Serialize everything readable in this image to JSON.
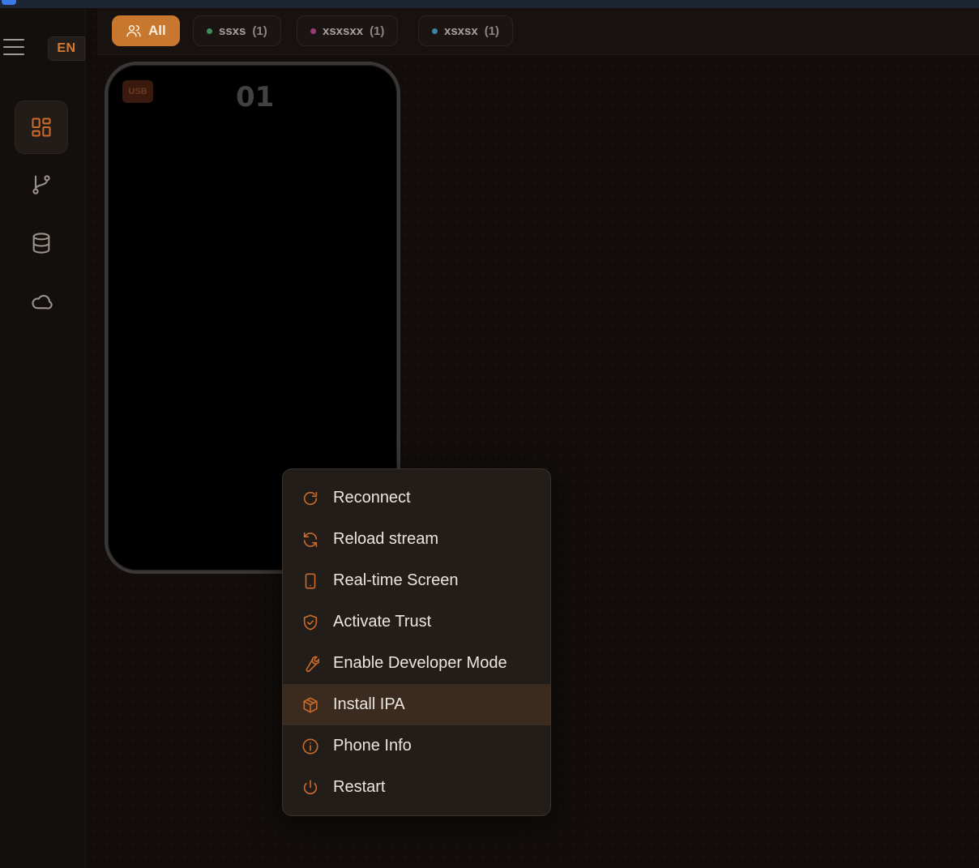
{
  "sidebar": {
    "language": "EN",
    "nav_items": [
      {
        "id": "dashboard",
        "icon": "dashboard-grid-icon",
        "active": true
      },
      {
        "id": "flows",
        "icon": "git-branch-icon",
        "active": false
      },
      {
        "id": "database",
        "icon": "database-icon",
        "active": false
      },
      {
        "id": "cloud",
        "icon": "cloud-icon",
        "active": false
      }
    ]
  },
  "filters": [
    {
      "label": "All",
      "count": "",
      "dot_color": "",
      "active": true,
      "icon": "users-icon"
    },
    {
      "label": "ssxs",
      "count": "(1)",
      "dot_color": "#3f8f5a",
      "active": false
    },
    {
      "label": "xsxsxx",
      "count": "(1)",
      "dot_color": "#9c3a78",
      "active": false
    },
    {
      "label": "xsxsx",
      "count": "(1)",
      "dot_color": "#3a86a6",
      "active": false
    }
  ],
  "device": {
    "connection_badge": "USB",
    "index": "01"
  },
  "context_menu": {
    "items": [
      {
        "label": "Reconnect",
        "icon": "reconnect-icon",
        "hover": false
      },
      {
        "label": "Reload stream",
        "icon": "reload-icon",
        "hover": false
      },
      {
        "label": "Real-time Screen",
        "icon": "phone-icon",
        "hover": false
      },
      {
        "label": "Activate Trust",
        "icon": "shield-check-icon",
        "hover": false
      },
      {
        "label": "Enable Developer Mode",
        "icon": "wrench-icon",
        "hover": false
      },
      {
        "label": "Install IPA",
        "icon": "package-icon",
        "hover": true
      },
      {
        "label": "Phone Info",
        "icon": "info-icon",
        "hover": false
      },
      {
        "label": "Restart",
        "icon": "power-icon",
        "hover": false
      }
    ]
  },
  "colors": {
    "accent": "#c8782e",
    "icon_accent": "#c9692a",
    "background": "#120d0b"
  }
}
